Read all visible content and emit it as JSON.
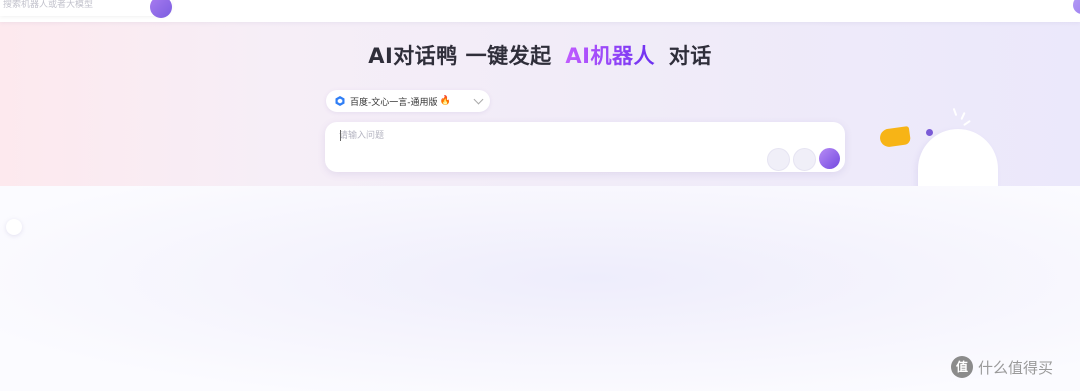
{
  "search": {
    "placeholder": "搜索机器人或者大模型"
  },
  "hero": {
    "title_prefix": "AI对话鸭 一键发起",
    "title_accent": "AI机器人",
    "title_suffix": "对话"
  },
  "model_select": {
    "selected": "百度-文心一言-通用版",
    "badge_icon": "fire-icon"
  },
  "chat": {
    "placeholder": "请输入问题"
  },
  "watermark": {
    "logo_char": "值",
    "text": "什么值得买"
  },
  "colors": {
    "accent": "#7b5de0",
    "beak": "#f7b416"
  }
}
